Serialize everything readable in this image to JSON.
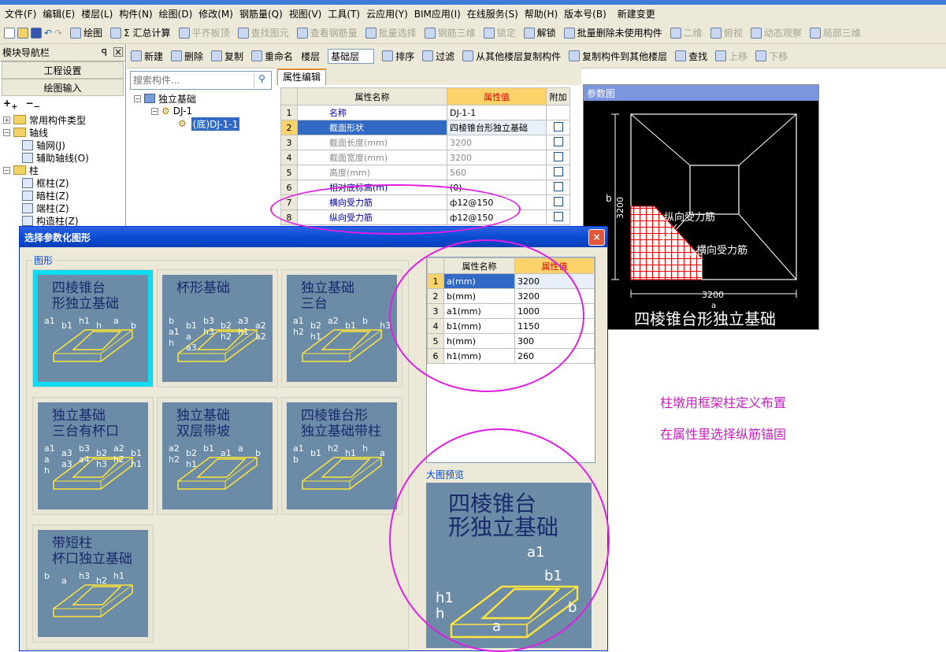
{
  "menubar": {
    "items": [
      "文件(F)",
      "编辑(E)",
      "楼层(L)",
      "构件(N)",
      "绘图(D)",
      "修改(M)",
      "钢筋量(Q)",
      "视图(V)",
      "工具(T)",
      "云应用(Y)",
      "BIM应用(I)",
      "在线服务(S)",
      "帮助(H)",
      "版本号(B)",
      "新建变更"
    ]
  },
  "toolbar1": {
    "items": [
      "绘图",
      "Σ 汇总计算",
      "平齐板顶",
      "查找图元",
      "查看钢筋量",
      "批量选择",
      "钢筋三维",
      "锁定",
      "解锁",
      "批量删除未使用构件",
      "二维",
      "俯视",
      "动态观察",
      "局部三维"
    ]
  },
  "navpanel": {
    "title": "模块导航栏",
    "pin": "ꟼ",
    "close": "×",
    "btn_project": "工程设置",
    "btn_draw": "绘图输入",
    "tree": [
      {
        "label": "常用构件类型",
        "indent": 0,
        "type": "folder"
      },
      {
        "label": "轴线",
        "indent": 0,
        "type": "folder"
      },
      {
        "label": "轴网(J)",
        "indent": 1,
        "type": "item"
      },
      {
        "label": "辅助轴线(O)",
        "indent": 1,
        "type": "item"
      },
      {
        "label": "柱",
        "indent": 0,
        "type": "folder"
      },
      {
        "label": "框柱(Z)",
        "indent": 1,
        "type": "item"
      },
      {
        "label": "暗柱(Z)",
        "indent": 1,
        "type": "item"
      },
      {
        "label": "端柱(Z)",
        "indent": 1,
        "type": "item"
      },
      {
        "label": "构造柱(Z)",
        "indent": 1,
        "type": "item"
      }
    ]
  },
  "toolbar2": {
    "items": [
      "新建",
      "删除",
      "复制",
      "重命名",
      "楼层",
      "基础层",
      "排序",
      "过滤",
      "从其他楼层复制构件",
      "复制构件到其他楼层",
      "查找",
      "上移",
      "下移"
    ]
  },
  "search": {
    "placeholder": "搜索构件..."
  },
  "comptree": {
    "root": "独立基础",
    "child": "DJ-1",
    "leaf": "(底)DJ-1-1"
  },
  "props": {
    "tab": "属性编辑",
    "headers": [
      "属性名称",
      "属性值",
      "附加"
    ],
    "rows": [
      {
        "n": "1",
        "name": "名称",
        "value": "DJ-1-1",
        "gray": false,
        "check": false
      },
      {
        "n": "2",
        "name": "截面形状",
        "value": "四棱锥台形独立基础",
        "gray": false,
        "check": true
      },
      {
        "n": "3",
        "name": "截面长度(mm)",
        "value": "3200",
        "gray": true,
        "check": true
      },
      {
        "n": "4",
        "name": "截面宽度(mm)",
        "value": "3200",
        "gray": true,
        "check": true
      },
      {
        "n": "5",
        "name": "高度(mm)",
        "value": "560",
        "gray": true,
        "check": true
      },
      {
        "n": "6",
        "name": "相对底标高(m)",
        "value": "(0)",
        "gray": false,
        "check": true
      },
      {
        "n": "7",
        "name": "横向受力筋",
        "value": "ф12@150",
        "gray": false,
        "check": true
      },
      {
        "n": "8",
        "name": "纵向受力筋",
        "value": "ф12@150",
        "gray": false,
        "check": true
      }
    ]
  },
  "param": {
    "title": "参数图",
    "dim_b": "b",
    "dim_b_val": "3200",
    "dim_a_val": "3200",
    "dim_a": "a",
    "label_long": "纵向受力筋",
    "label_trans": "横向受力筋",
    "caption": "四棱锥台形独立基础"
  },
  "dialog": {
    "title": "选择参数化图形",
    "close": "×",
    "group": "图形",
    "shapes": [
      {
        "name": "四棱锥台形独立基础",
        "l1": "四棱锥台",
        "l2": "形独立基础",
        "sel": true,
        "labels": [
          "a1",
          "b1",
          "h1",
          "h",
          "a",
          "b"
        ]
      },
      {
        "name": "杯形基础",
        "l1": "杯形基础",
        "l2": "",
        "sel": false,
        "labels": [
          "b",
          "b1",
          "b3",
          "b2",
          "a3",
          "a2",
          "a1",
          "a",
          "h3",
          "h2",
          "h1",
          "a2",
          "h",
          "a3"
        ]
      },
      {
        "name": "独立基础三台",
        "l1": "独立基础",
        "l2": "三台",
        "sel": false,
        "labels": [
          "a1",
          "b2",
          "a2",
          "b1",
          "b",
          "h3",
          "h2",
          "h1"
        ]
      },
      {
        "name": "独立基础三台有杯口",
        "l1": "独立基础",
        "l2": "三台有杯口",
        "sel": false,
        "labels": [
          "a1",
          "a3",
          "b3",
          "b2",
          "a2",
          "b1",
          "a",
          "a3",
          "a4",
          "h3",
          "h2",
          "h1",
          "h"
        ]
      },
      {
        "name": "独立基础双层带坡",
        "l1": "独立基础",
        "l2": "双层带坡",
        "sel": false,
        "labels": [
          "a2",
          "b2",
          "b1",
          "a1",
          "a",
          "b",
          "h2",
          "h1"
        ]
      },
      {
        "name": "四棱锥台形独立基础带柱",
        "l1": "四棱锥台形",
        "l2": "独立基础带柱",
        "sel": false,
        "labels": [
          "a1",
          "b1",
          "h2",
          "h1",
          "h",
          "a",
          "b"
        ]
      },
      {
        "name": "带短柱杯口独立基础",
        "l1": "带短柱",
        "l2": "杯口独立基础",
        "sel": false,
        "labels": [
          "b",
          "a",
          "h3",
          "h2",
          "h1"
        ]
      }
    ],
    "ptable": {
      "headers": [
        "属性名称",
        "属性值"
      ],
      "rows": [
        {
          "n": "1",
          "name": "a(mm)",
          "value": "3200"
        },
        {
          "n": "2",
          "name": "b(mm)",
          "value": "3200"
        },
        {
          "n": "3",
          "name": "a1(mm)",
          "value": "1000"
        },
        {
          "n": "4",
          "name": "b1(mm)",
          "value": "1150"
        },
        {
          "n": "5",
          "name": "h(mm)",
          "value": "300"
        },
        {
          "n": "6",
          "name": "h1(mm)",
          "value": "260"
        }
      ]
    },
    "preview_label": "大图预览",
    "preview": {
      "l1": "四棱锥台",
      "l2": "形独立基础",
      "labels": [
        "a1",
        "b1",
        "h1",
        "h",
        "a",
        "b"
      ]
    }
  },
  "notes": {
    "line1": "柱墩用框架柱定义布置",
    "line2": "在属性里选择纵筋锚固"
  },
  "colors": {
    "highlight": "#e01fe6",
    "note": "#c81ec0",
    "title_bar": "#0a4bd4",
    "selected_card": "#0fdcf2",
    "preview_bg": "#6b8ba7"
  }
}
